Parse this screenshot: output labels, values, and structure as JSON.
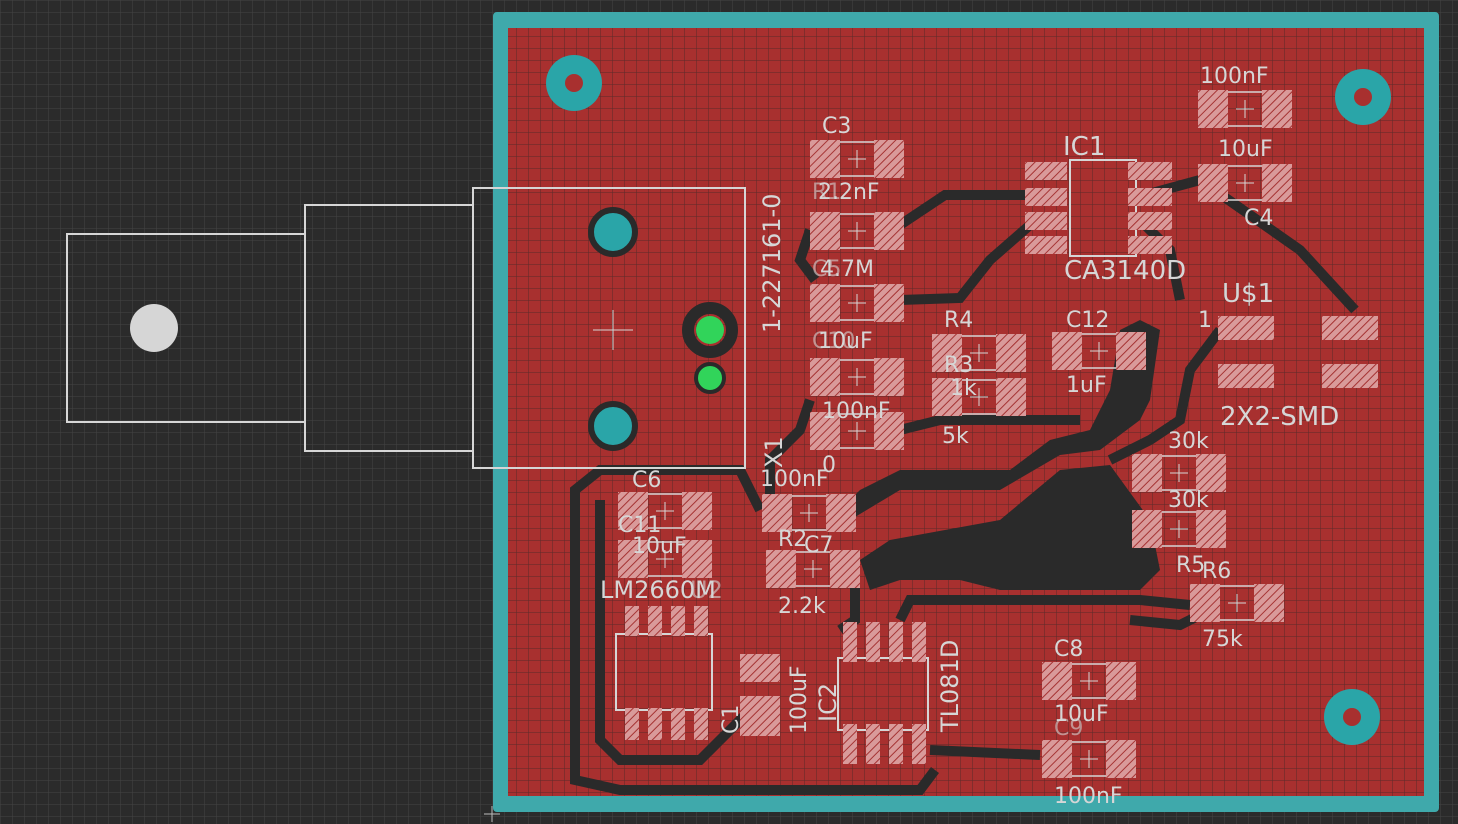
{
  "colors": {
    "background": "#2b2b2b",
    "grid": "#3f3f3f",
    "board_outline": "#3fa9ab",
    "copper_pour": "#a8302f",
    "trace_isolation": "#2a2a2a",
    "silkscreen": "#d6d6d6",
    "pad": "#d99a9a",
    "via_green": "#31d45a",
    "via_teal": "#2aa5a8"
  },
  "icons": [
    "crosshair-icon",
    "pad-hatch-icon",
    "mounting-hole-icon"
  ],
  "labels": {
    "c3": "C3",
    "c3_val": "2.2nF",
    "r1": "R1",
    "r1_val": "4.7M",
    "c5": "C5",
    "c5_val": "10uF",
    "c10": "C10",
    "c10_val": "100nF",
    "x1": "X1",
    "zero": "0",
    "ic1": "IC1",
    "ic1_part": "CA3140D",
    "c4_val_top": "100nF",
    "c4_val_mid": "10uF",
    "c4": "C4",
    "u1": "U$1",
    "u1_pin": "1",
    "u1_part": "2X2-SMD",
    "r4": "R4",
    "r3": "R3",
    "r3_val": "1k",
    "r4_val": "5k",
    "c12": "C12",
    "c12_val": "1uF",
    "connector": "1-227161-0",
    "c6": "C6",
    "c6_val": "100nF",
    "c11": "C11",
    "c11_val": "10uF",
    "lm": "LM2660M",
    "u2": "U2",
    "r2": "R2",
    "r2_val": "2.2k",
    "c7": "C7",
    "c7_val": "100nF",
    "c1_val": "100uF",
    "c1": "C1",
    "ic2": "IC2",
    "ic2_part": "TL081D",
    "r5_val_top": "30k",
    "r5_val_mid": "30k",
    "r5": "R5",
    "r6": "R6",
    "r6_val": "75k",
    "c8": "C8",
    "c8_val": "10uF",
    "c9": "C9",
    "c9_val": "100nF"
  }
}
